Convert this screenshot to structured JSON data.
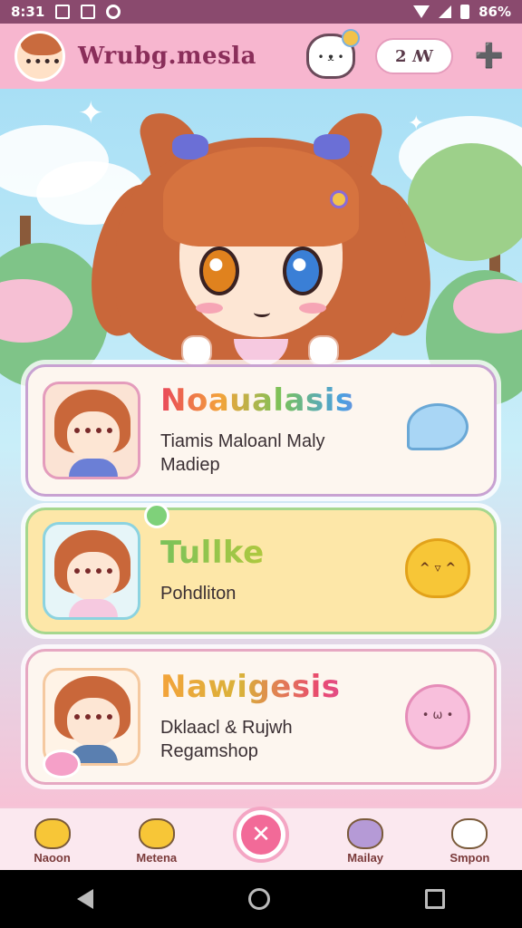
{
  "status_bar": {
    "time": "8:31",
    "battery": "86%"
  },
  "header": {
    "title": "Wrubg.mesla",
    "pill_label": "2 ꟿ",
    "menu_icon": "➕"
  },
  "cards": [
    {
      "title": "Noaualasis",
      "desc_line1": "Tiamis  Maloanl Maly",
      "desc_line2": "Madiep",
      "icon": "speech-bubble-icon"
    },
    {
      "title": "Tullke",
      "desc_line1": "Pohdliton",
      "desc_line2": "",
      "icon": "chick-icon"
    },
    {
      "title": "Nawigesis",
      "desc_line1": "Dklaacl & Rujwh",
      "desc_line2": "Regamshop",
      "icon": "kitty-icon"
    }
  ],
  "bottom_nav": {
    "items": [
      {
        "label": "Naoon",
        "icon": "chick-icon",
        "color": "#f7c637"
      },
      {
        "label": "Metena",
        "icon": "chick-icon",
        "color": "#f7c637"
      },
      {
        "label": "",
        "icon": "close-icon",
        "color": "#f26a98"
      },
      {
        "label": "Mailay",
        "icon": "mascot-icon",
        "color": "#b59ad6"
      },
      {
        "label": "Smpon",
        "icon": "bunny-icon",
        "color": "#ffffff"
      }
    ]
  },
  "colors": {
    "header_bg": "#f7b6cf",
    "status_bg": "#8a4a6e",
    "accent": "#f26a98"
  }
}
